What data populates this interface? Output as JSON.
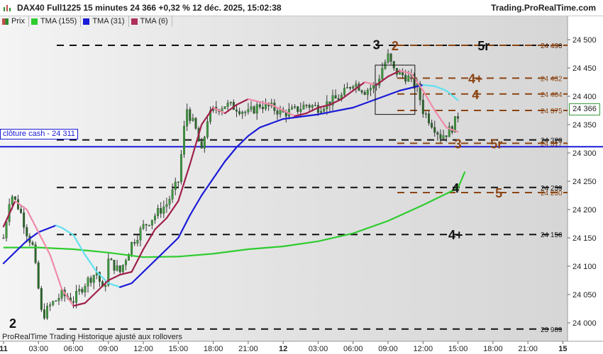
{
  "header": {
    "title": "DAX40 Full1225 15 minutes 24 366 +0,32 % 12 déc. 2025, 15:02:38",
    "site": "Trading.ProRealTime.com"
  },
  "legend": [
    {
      "label": "Prix",
      "color": "#c0504d"
    },
    {
      "label": "TMA (155)",
      "color": "#2ecc2e"
    },
    {
      "label": "TMA (31)",
      "color": "#1a1ad8"
    },
    {
      "label": "TMA (6)",
      "color": "#b0305a"
    }
  ],
  "footer": "ProRealTime Trading  Historique ajusté aux rollovers",
  "cash_label": "clôture cash -  24 311",
  "last_price": "24 366",
  "chart_data": {
    "type": "candlestick",
    "yaxis": {
      "min": 23975,
      "max": 24520,
      "ticks": [
        24000,
        24050,
        24100,
        24150,
        24200,
        24250,
        24300,
        24350,
        24400,
        24450,
        24500
      ]
    },
    "xaxis_ticks": [
      {
        "label": "11",
        "t": 0,
        "bold": true
      },
      {
        "label": "03:00",
        "t": 3
      },
      {
        "label": "06:00",
        "t": 6
      },
      {
        "label": "09:00",
        "t": 9
      },
      {
        "label": "12:00",
        "t": 12
      },
      {
        "label": "15:00",
        "t": 15
      },
      {
        "label": "18:00",
        "t": 18
      },
      {
        "label": "21:00",
        "t": 21
      },
      {
        "label": "12",
        "t": 24,
        "bold": true
      },
      {
        "label": "03:00",
        "t": 27
      },
      {
        "label": "06:00",
        "t": 30
      },
      {
        "label": "09:00",
        "t": 33
      },
      {
        "label": "12:00",
        "t": 36
      },
      {
        "label": "15:00",
        "t": 39
      },
      {
        "label": "18:00",
        "t": 42
      },
      {
        "label": "21:00",
        "t": 45
      },
      {
        "label": "15",
        "t": 48,
        "bold": true
      }
    ],
    "levels_black": [
      {
        "value": 24490,
        "label": "24 490"
      },
      {
        "value": 24323,
        "label": "24 323"
      },
      {
        "value": 24239,
        "label": "24 239"
      },
      {
        "value": 24156,
        "label": "24 156"
      },
      {
        "value": 23989,
        "label": "23 989"
      }
    ],
    "levels_brown": [
      {
        "value": 24490,
        "label": "24 490"
      },
      {
        "value": 24432,
        "label": "24 432"
      },
      {
        "value": 24404,
        "label": "24 404"
      },
      {
        "value": 24375,
        "label": "24 375"
      },
      {
        "value": 24317,
        "label": "24 317"
      },
      {
        "value": 24230,
        "label": "24 230"
      }
    ],
    "cash_close": 24311,
    "last_price": 24366,
    "annotations_black": [
      {
        "text": "3",
        "t": 32,
        "v": 24492
      },
      {
        "text": "5r",
        "t": 41.2,
        "v": 24490
      },
      {
        "text": "4",
        "t": 38.8,
        "v": 24239
      },
      {
        "text": "4+",
        "t": 38.8,
        "v": 24156
      },
      {
        "text": "2",
        "t": 0.8,
        "v": 24000
      }
    ],
    "annotations_brown": [
      {
        "text": "2",
        "t": 33.6,
        "v": 24490
      },
      {
        "text": "4+",
        "t": 40.5,
        "v": 24432
      },
      {
        "text": "4",
        "t": 40.5,
        "v": 24404
      },
      {
        "text": "5r",
        "t": 42.3,
        "v": 24317
      },
      {
        "text": "3",
        "t": 39,
        "v": 24317
      },
      {
        "text": "5",
        "t": 42.5,
        "v": 24230
      }
    ],
    "tma155": [
      [
        0,
        24133
      ],
      [
        3,
        24133
      ],
      [
        6,
        24130
      ],
      [
        9,
        24124
      ],
      [
        12,
        24116
      ],
      [
        15,
        24117
      ],
      [
        18,
        24122
      ],
      [
        21,
        24130
      ],
      [
        24,
        24135
      ],
      [
        27,
        24144
      ],
      [
        30,
        24158
      ],
      [
        33,
        24180
      ],
      [
        36,
        24208
      ],
      [
        39,
        24238
      ],
      [
        39.6,
        24267
      ]
    ],
    "tma31": [
      [
        0,
        24105
      ],
      [
        1,
        24125
      ],
      [
        2,
        24145
      ],
      [
        3,
        24160
      ],
      [
        4,
        24168
      ],
      [
        4.5,
        24172
      ],
      [
        5,
        24168
      ],
      [
        6,
        24155
      ],
      [
        7,
        24120
      ],
      [
        8,
        24090
      ],
      [
        9,
        24070
      ],
      [
        10,
        24063
      ],
      [
        11,
        24070
      ],
      [
        12,
        24090
      ],
      [
        13,
        24110
      ],
      [
        14,
        24130
      ],
      [
        15,
        24150
      ],
      [
        16,
        24190
      ],
      [
        17,
        24225
      ],
      [
        18,
        24255
      ],
      [
        19,
        24285
      ],
      [
        20,
        24310
      ],
      [
        21,
        24330
      ],
      [
        22,
        24345
      ],
      [
        24,
        24360
      ],
      [
        27,
        24368
      ],
      [
        30,
        24380
      ],
      [
        32,
        24395
      ],
      [
        34,
        24410
      ],
      [
        36,
        24420
      ],
      [
        37,
        24418
      ],
      [
        38,
        24410
      ],
      [
        39,
        24393
      ]
    ],
    "tma6": [
      [
        0,
        24170
      ],
      [
        1,
        24215
      ],
      [
        2,
        24200
      ],
      [
        3,
        24160
      ],
      [
        4,
        24120
      ],
      [
        5,
        24060
      ],
      [
        6,
        24030
      ],
      [
        7,
        24035
      ],
      [
        8,
        24055
      ],
      [
        9,
        24075
      ],
      [
        10,
        24085
      ],
      [
        11,
        24090
      ],
      [
        12,
        24130
      ],
      [
        13,
        24165
      ],
      [
        14,
        24185
      ],
      [
        15,
        24215
      ],
      [
        16,
        24280
      ],
      [
        17,
        24350
      ],
      [
        18,
        24380
      ],
      [
        19,
        24370
      ],
      [
        20,
        24385
      ],
      [
        21,
        24395
      ],
      [
        22,
        24390
      ],
      [
        23,
        24385
      ],
      [
        24,
        24375
      ],
      [
        25,
        24365
      ],
      [
        26,
        24370
      ],
      [
        27,
        24380
      ],
      [
        28,
        24385
      ],
      [
        29,
        24395
      ],
      [
        30,
        24410
      ],
      [
        31,
        24425
      ],
      [
        32,
        24420
      ],
      [
        33,
        24435
      ],
      [
        34,
        24445
      ],
      [
        35,
        24440
      ],
      [
        36,
        24410
      ],
      [
        37,
        24375
      ],
      [
        38,
        24345
      ],
      [
        39,
        24337
      ]
    ],
    "candles_keys": [
      [
        0,
        24150
      ],
      [
        0.6,
        24230
      ],
      [
        1.4,
        24200
      ],
      [
        2,
        24160
      ],
      [
        2.5,
        24135
      ],
      [
        3,
        24060
      ],
      [
        3.3,
        24010
      ],
      [
        4,
        24030
      ],
      [
        5,
        24050
      ],
      [
        6,
        24040
      ],
      [
        7,
        24070
      ],
      [
        8,
        24090
      ],
      [
        8.6,
        24050
      ],
      [
        9,
        24110
      ],
      [
        10,
        24090
      ],
      [
        11,
        24140
      ],
      [
        12,
        24170
      ],
      [
        13,
        24190
      ],
      [
        14,
        24210
      ],
      [
        15,
        24250
      ],
      [
        15.7,
        24380
      ],
      [
        16.5,
        24340
      ],
      [
        17,
        24300
      ],
      [
        17.5,
        24360
      ],
      [
        18,
        24375
      ],
      [
        19,
        24385
      ],
      [
        20,
        24380
      ],
      [
        21,
        24370
      ],
      [
        22,
        24385
      ],
      [
        23,
        24380
      ],
      [
        24,
        24370
      ],
      [
        25,
        24375
      ],
      [
        26,
        24385
      ],
      [
        27,
        24380
      ],
      [
        28,
        24390
      ],
      [
        29,
        24400
      ],
      [
        30,
        24425
      ],
      [
        31,
        24410
      ],
      [
        32,
        24420
      ],
      [
        32.5,
        24450
      ],
      [
        33,
        24470
      ],
      [
        33.5,
        24445
      ],
      [
        34,
        24440
      ],
      [
        35,
        24430
      ],
      [
        35.5,
        24415
      ],
      [
        36,
        24375
      ],
      [
        37,
        24345
      ],
      [
        37.5,
        24330
      ],
      [
        38,
        24335
      ],
      [
        38.5,
        24345
      ],
      [
        39,
        24366
      ]
    ],
    "box": {
      "t0": 31.9,
      "t1": 35.3,
      "v0": 24368,
      "v1": 24455
    }
  }
}
